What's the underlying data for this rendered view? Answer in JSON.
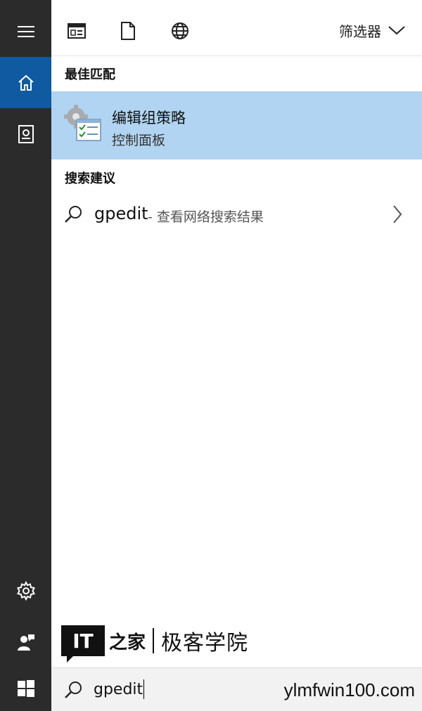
{
  "sidebar": {
    "items": [
      {
        "name": "menu",
        "icon": "hamburger-menu-icon"
      },
      {
        "name": "home",
        "icon": "home-icon",
        "active": true
      },
      {
        "name": "notebook",
        "icon": "notebook-icon"
      },
      {
        "name": "settings",
        "icon": "gear-icon"
      },
      {
        "name": "feedback",
        "icon": "person-feedback-icon"
      },
      {
        "name": "start",
        "icon": "windows-logo-icon"
      }
    ]
  },
  "toolbar": {
    "icons": [
      "apps-icon",
      "document-icon",
      "web-globe-icon"
    ],
    "filter_label": "筛选器"
  },
  "best_match": {
    "title": "最佳匹配",
    "item_title": "编辑组策略",
    "item_subtitle": "控制面板",
    "highlight_color": "#b0d4f1"
  },
  "suggestions": {
    "title": "搜索建议",
    "items": [
      {
        "term": "gpedit",
        "description": "- 查看网络搜索结果"
      }
    ]
  },
  "watermark": {
    "logo_text": "IT",
    "seal_text": "之家",
    "brand_text": "极客学院",
    "site_text": "ylmfwin100.com"
  },
  "search": {
    "value": "gpedit"
  },
  "colors": {
    "sidebar": "#2b2b2b",
    "accent": "#0f5aa0"
  }
}
